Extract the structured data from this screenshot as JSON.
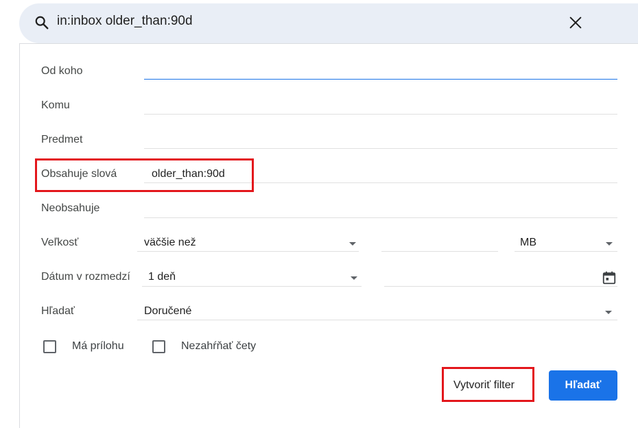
{
  "search": {
    "query": "in:inbox older_than:90d"
  },
  "form": {
    "from_label": "Od koho",
    "to_label": "Komu",
    "subject_label": "Predmet",
    "has_words_label": "Obsahuje slová",
    "has_words_value": "older_than:90d",
    "doesnt_have_label": "Neobsahuje",
    "size_label": "Veľkosť",
    "size_operator": "väčšie než",
    "size_unit": "MB",
    "date_label": "Dátum v rozmedzí",
    "date_range": "1 deň",
    "search_in_label": "Hľadať",
    "search_in_value": "Doručené",
    "has_attachment_label": "Má prílohu",
    "exclude_chats_label": "Nezahŕňať čety",
    "create_filter_label": "Vytvoriť filter",
    "search_button_label": "Hľadať"
  },
  "colors": {
    "accent": "#1a73e8",
    "highlight": "#e3161b",
    "search_bg": "#e9eef6"
  },
  "icons": [
    "search-icon",
    "close-icon",
    "dropdown-arrow-icon",
    "calendar-icon",
    "checkbox-icon"
  ]
}
